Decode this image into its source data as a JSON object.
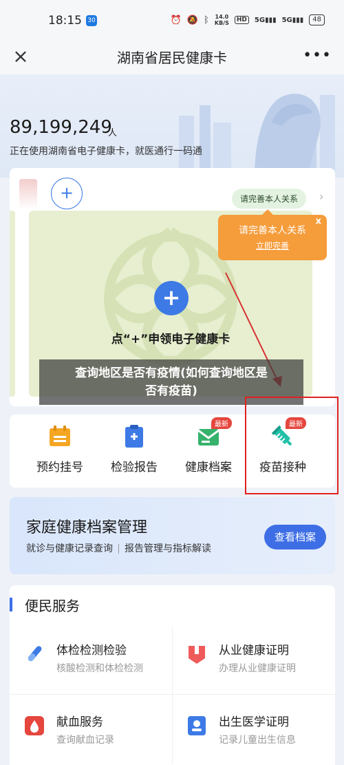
{
  "status": {
    "time": "18:15",
    "badge": "30",
    "net_speed_value": "14.0",
    "net_speed_unit": "KB/S",
    "hd": "HD",
    "signal1": "5G",
    "signal2": "5G",
    "battery": "48"
  },
  "nav": {
    "close": "×",
    "title": "湖南省居民健康卡",
    "more": "•••"
  },
  "hero": {
    "count": "89,199,249",
    "unit": "人",
    "subtitle": "正在使用湖南省电子健康卡，就医通行一码通"
  },
  "card": {
    "add_symbol": "+",
    "relation_pill": "请完善本人关系",
    "qr_plus": "+",
    "apply_text": "点“+”申领电子健康卡"
  },
  "popup": {
    "title": "请完善本人关系",
    "link": "立即完善",
    "close": "x"
  },
  "overlay": {
    "line1": "查询地区是否有疫情(如何查询地区是",
    "line2": "否有疫苗)"
  },
  "services": [
    {
      "label": "预约挂号",
      "icon": "calendar-icon",
      "color": "#f5a623",
      "badge": ""
    },
    {
      "label": "检验报告",
      "icon": "report-icon",
      "color": "#3d7ae6",
      "badge": ""
    },
    {
      "label": "健康档案",
      "icon": "archive-icon",
      "color": "#35b26b",
      "badge": "最新"
    },
    {
      "label": "疫苗接种",
      "icon": "syringe-icon",
      "color": "#21c0a8",
      "badge": "最新"
    }
  ],
  "archive": {
    "title": "家庭健康档案管理",
    "sub1": "就诊与健康记录查询",
    "sub2": "报告管理与指标解读",
    "button": "查看档案"
  },
  "convenience": {
    "title": "便民服务",
    "items": [
      {
        "title": "体检检测检验",
        "sub": "核酸检测和体检检测",
        "icon": "test-tube-icon",
        "color": "#3d7ae6"
      },
      {
        "title": "从业健康证明",
        "sub": "办理从业健康证明",
        "icon": "id-badge-icon",
        "color": "#ef5a5a"
      },
      {
        "title": "献血服务",
        "sub": "查询献血记录",
        "icon": "blood-drop-icon",
        "color": "#e5463e"
      },
      {
        "title": "出生医学证明",
        "sub": "记录儿童出生信息",
        "icon": "person-card-icon",
        "color": "#3d7ae6"
      }
    ]
  }
}
